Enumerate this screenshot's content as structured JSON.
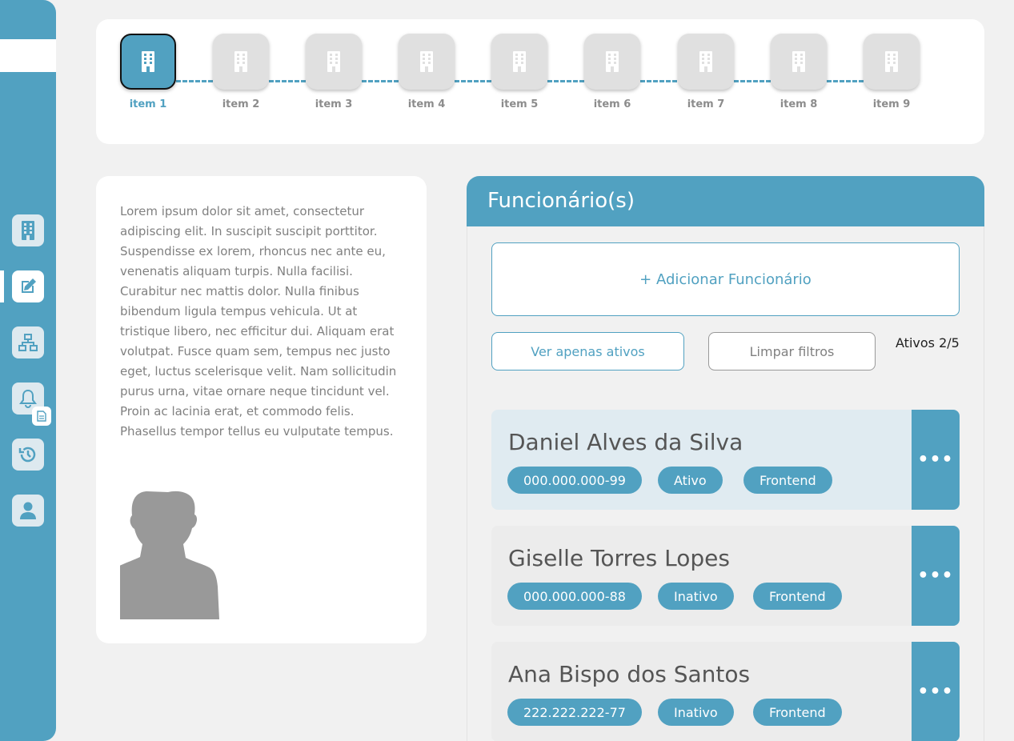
{
  "colors": {
    "accent": "#51a1c1",
    "background": "#f1f1f1",
    "card": "#ffffff",
    "step_inactive": "#e0e0e0",
    "text_muted": "#808080"
  },
  "sidebar": {
    "icons": [
      "building-icon",
      "edit-icon",
      "sitemap-icon",
      "bell-icon",
      "history-icon",
      "user-icon"
    ],
    "badge_icon": "document-icon"
  },
  "stepper": {
    "icon": "building-icon",
    "items": [
      {
        "label": "item 1",
        "active": true
      },
      {
        "label": "item 2",
        "active": false
      },
      {
        "label": "item 3",
        "active": false
      },
      {
        "label": "item 4",
        "active": false
      },
      {
        "label": "item 5",
        "active": false
      },
      {
        "label": "item 6",
        "active": false
      },
      {
        "label": "item 7",
        "active": false
      },
      {
        "label": "item 8",
        "active": false
      },
      {
        "label": "item 9",
        "active": false
      }
    ]
  },
  "info": {
    "text": "Lorem ipsum dolor sit amet, consectetur adipiscing elit. In suscipit suscipit porttitor. Suspendisse ex lorem, rhoncus nec ante eu, venenatis aliquam turpis. Nulla facilisi. Curabitur nec mattis dolor. Nulla finibus bibendum ligula tempus vehicula. Ut at tristique libero, nec efficitur dui. Aliquam erat volutpat. Fusce quam sem, tempus nec justo eget, luctus scelerisque velit. Nam sollicitudin purus urna, vitae ornare neque tincidunt vel. Proin ac lacinia erat, et commodo felis. Phasellus tempor tellus eu vulputate tempus."
  },
  "panel": {
    "title": "Funcionário(s)",
    "add_label": "+ Adicionar Funcionário",
    "filter_active_label": "Ver apenas ativos",
    "clear_filters_label": "Limpar filtros",
    "active_count": "Ativos 2/5",
    "more_label": "•••"
  },
  "employees": [
    {
      "name": "Daniel Alves da Silva",
      "cpf": "000.000.000-99",
      "status": "Ativo",
      "area": "Frontend",
      "selected": true
    },
    {
      "name": "Giselle Torres Lopes",
      "cpf": "000.000.000-88",
      "status": "Inativo",
      "area": "Frontend",
      "selected": false
    },
    {
      "name": "Ana Bispo dos Santos",
      "cpf": "222.222.222-77",
      "status": "Inativo",
      "area": "Frontend",
      "selected": false
    }
  ]
}
